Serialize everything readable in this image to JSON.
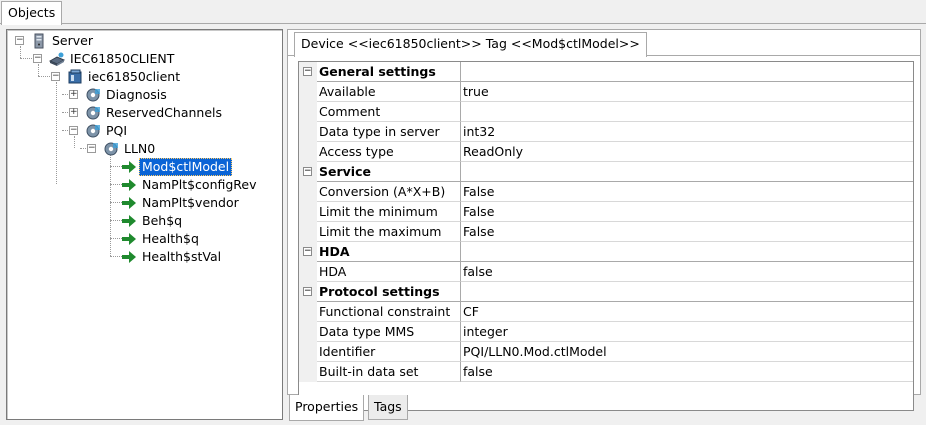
{
  "top_tab": {
    "label": "Objects"
  },
  "tree": {
    "items": [
      {
        "label": "Server",
        "icon": "server-icon"
      },
      {
        "label": "IEC61850CLIENT",
        "icon": "network-device-icon"
      },
      {
        "label": "iec61850client",
        "icon": "device-icon"
      },
      {
        "label": "Diagnosis",
        "icon": "gear-icon"
      },
      {
        "label": "ReservedChannels",
        "icon": "gear-icon"
      },
      {
        "label": "PQI",
        "icon": "gear-icon"
      },
      {
        "label": "LLN0",
        "icon": "gear-icon"
      },
      {
        "label": "Mod$ctlModel",
        "icon": "tag-arrow-icon",
        "selected": true
      },
      {
        "label": "NamPlt$configRev",
        "icon": "tag-arrow-icon"
      },
      {
        "label": "NamPlt$vendor",
        "icon": "tag-arrow-icon"
      },
      {
        "label": "Beh$q",
        "icon": "tag-arrow-icon"
      },
      {
        "label": "Health$q",
        "icon": "tag-arrow-icon"
      },
      {
        "label": "Health$stVal",
        "icon": "tag-arrow-icon"
      }
    ]
  },
  "properties": {
    "tab_label": "Device <<iec61850client>> Tag <<Mod$ctlModel>>",
    "rows": [
      {
        "type": "category",
        "name": "General settings",
        "value": ""
      },
      {
        "type": "prop",
        "name": "Available",
        "value": "true"
      },
      {
        "type": "prop",
        "name": "Comment",
        "value": ""
      },
      {
        "type": "prop",
        "name": "Data type in server",
        "value": "int32"
      },
      {
        "type": "prop",
        "name": "Access type",
        "value": "ReadOnly"
      },
      {
        "type": "category",
        "name": "Service",
        "value": ""
      },
      {
        "type": "prop",
        "name": "Conversion (A*X+B)",
        "value": "False"
      },
      {
        "type": "prop",
        "name": "Limit the minimum",
        "value": "False"
      },
      {
        "type": "prop",
        "name": "Limit the maximum",
        "value": "False"
      },
      {
        "type": "category",
        "name": "HDA",
        "value": ""
      },
      {
        "type": "prop",
        "name": "HDA",
        "value": "false"
      },
      {
        "type": "category",
        "name": "Protocol settings",
        "value": ""
      },
      {
        "type": "prop",
        "name": "Functional constraint",
        "value": "CF"
      },
      {
        "type": "prop",
        "name": "Data type MMS",
        "value": "integer"
      },
      {
        "type": "prop",
        "name": "Identifier",
        "value": "PQI/LLN0.Mod.ctlModel"
      },
      {
        "type": "prop",
        "name": "Built-in data set",
        "value": "false"
      }
    ]
  },
  "bottom_tabs": {
    "properties": "Properties",
    "tags": "Tags"
  },
  "colors": {
    "selection": "#0a64d6",
    "tag_arrow": "#1f8a2e"
  }
}
